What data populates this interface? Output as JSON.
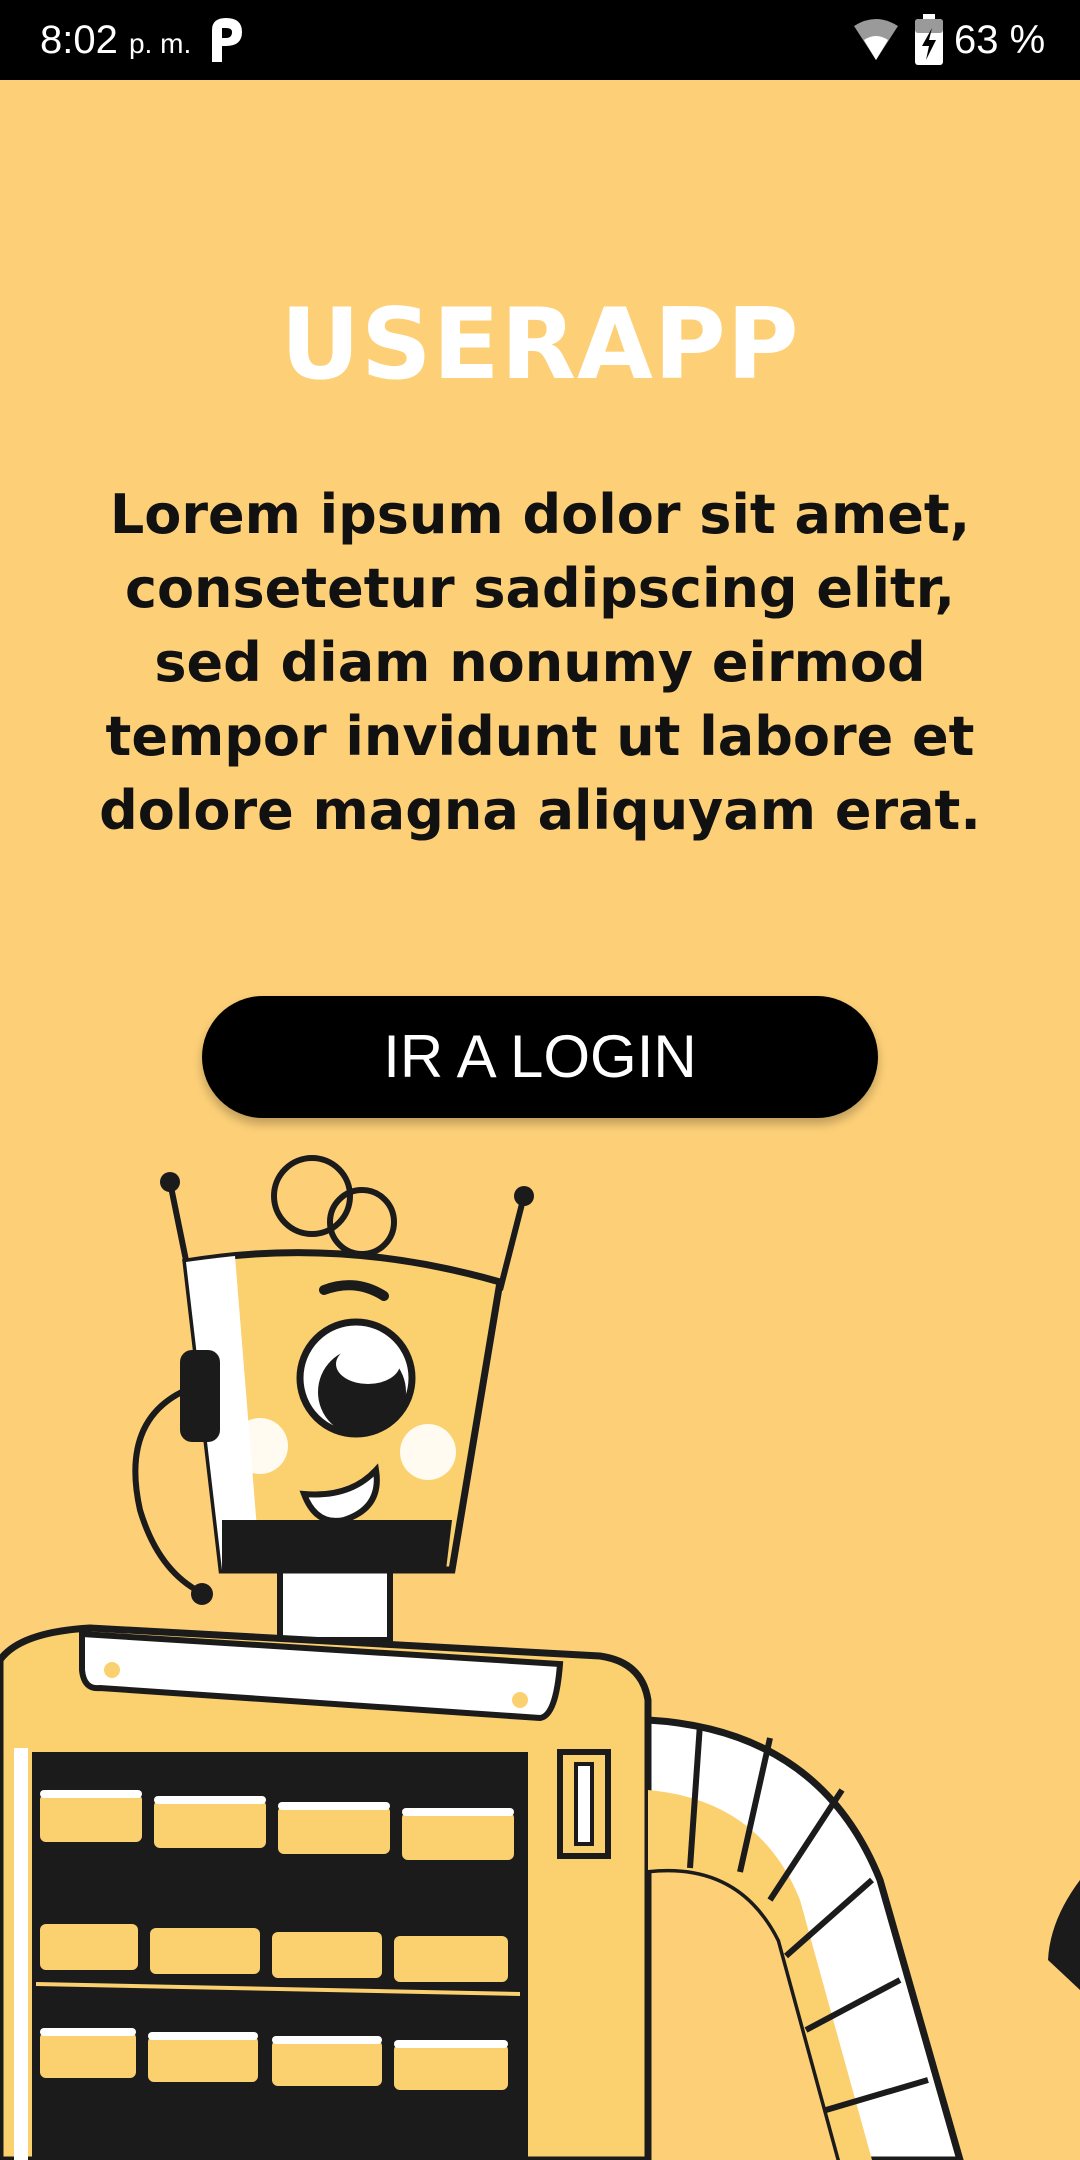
{
  "status_bar": {
    "time": "8:02",
    "ampm": "p. m.",
    "battery": "63 %",
    "icons": [
      "p-app-icon",
      "wifi-icon",
      "battery-charging-icon"
    ]
  },
  "main": {
    "title": "USERAPP",
    "description": "Lorem ipsum dolor sit amet, consetetur sadipscing elitr, sed diam nonumy eirmod tempor invidunt ut labore et dolore magna aliquyam erat.",
    "login_button": "IR A LOGIN"
  },
  "colors": {
    "background": "#fdd078",
    "robot_yellow": "#fbd06f",
    "dark": "#1b1b1b",
    "white": "#ffffff"
  },
  "illustration": {
    "icon": "robot-illustration"
  }
}
